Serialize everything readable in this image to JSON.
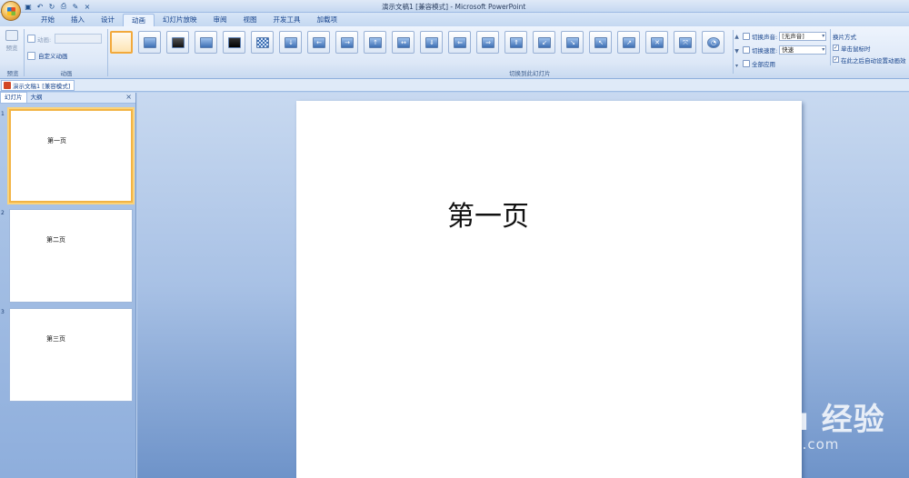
{
  "window": {
    "title": "演示文稿1 [兼容模式] - Microsoft PowerPoint"
  },
  "quick_access": [
    "save-icon",
    "undo-icon",
    "redo-icon",
    "print-preview-icon",
    "format-painter-icon",
    "close-icon"
  ],
  "tabs": [
    {
      "label": "开始"
    },
    {
      "label": "插入"
    },
    {
      "label": "设计"
    },
    {
      "label": "动画",
      "active": true
    },
    {
      "label": "幻灯片放映"
    },
    {
      "label": "审阅"
    },
    {
      "label": "视图"
    },
    {
      "label": "开发工具"
    },
    {
      "label": "加载项"
    }
  ],
  "ribbon": {
    "preview": {
      "label": "预览",
      "group_label": "预览"
    },
    "animations": {
      "group_label": "动画",
      "animate_label": "动画:",
      "custom_animation_label": "自定义动画"
    },
    "transition": {
      "group_label": "切换到此幻灯片",
      "sound_label": "切换声音:",
      "sound_value": "[无声音]",
      "speed_label": "切换速度:",
      "speed_value": "快速",
      "apply_all_label": "全部应用"
    },
    "advance": {
      "title": "换片方式",
      "on_click_label": "单击鼠标时",
      "on_click_checked": true,
      "auto_label": "在此之后自动设置动画效",
      "auto_checked": true
    }
  },
  "document_tab": {
    "label": "演示文稿1 [兼容模式]"
  },
  "left_panel": {
    "tabs": [
      {
        "label": "幻灯片",
        "active": true
      },
      {
        "label": "大纲"
      }
    ],
    "close": "×",
    "slides": [
      {
        "number": "1",
        "text": "第一页",
        "selected": true
      },
      {
        "number": "2",
        "text": "第二页"
      },
      {
        "number": "3",
        "text": "第三页"
      }
    ]
  },
  "slide": {
    "title": "第一页"
  },
  "watermark": {
    "brand": "Bai du 经验",
    "url": "jingyan.baidu.com"
  },
  "colors": {
    "accent": "#f2a93b",
    "ribbon_text": "#15428b",
    "slide_bg": "#ffffff"
  }
}
